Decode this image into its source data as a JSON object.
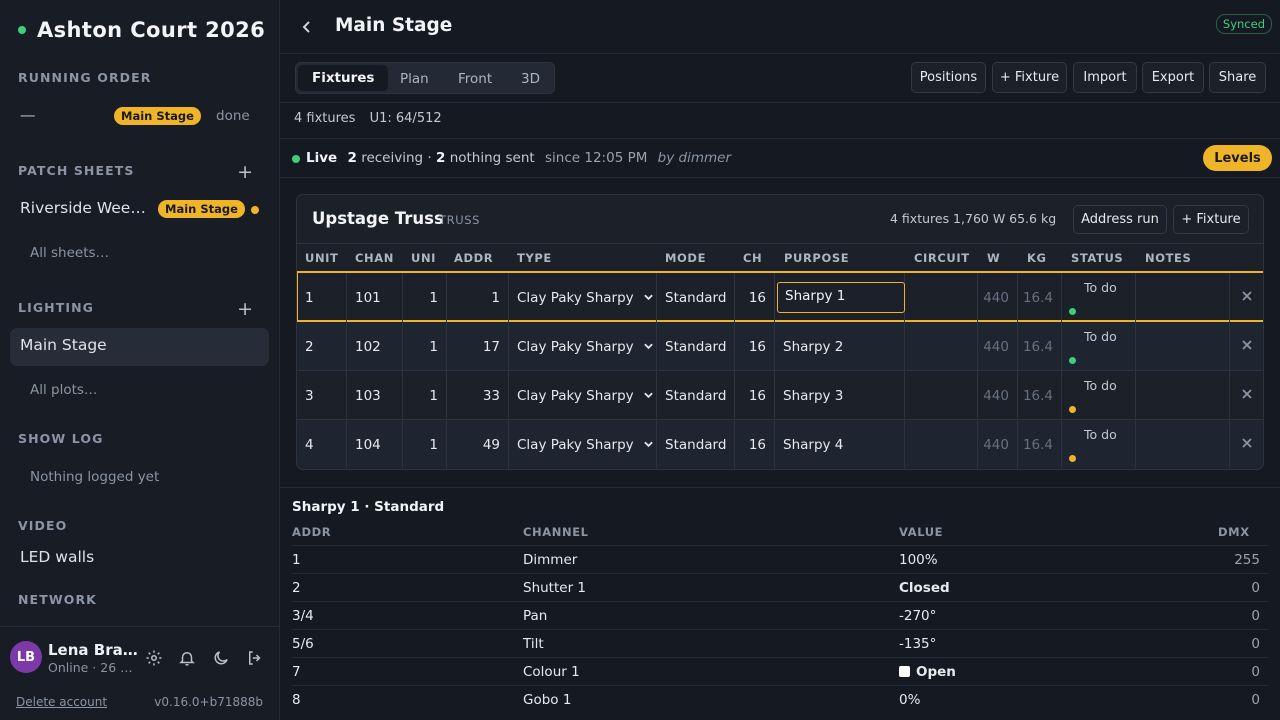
{
  "sidebar": {
    "brand": "Ashton Court 2026",
    "running_order": {
      "title": "RUNNING ORDER",
      "dash": "—",
      "pill": "Main Stage",
      "status": "done"
    },
    "patch_sheets": {
      "title": "PATCH SHEETS",
      "item": "Riverside Wee…",
      "pill": "Main Stage",
      "all": "All sheets…"
    },
    "lighting": {
      "title": "LIGHTING",
      "item": "Main Stage",
      "all": "All plots…"
    },
    "show_log": {
      "title": "SHOW LOG",
      "empty": "Nothing logged yet"
    },
    "video": {
      "title": "VIDEO",
      "item": "LED walls"
    },
    "network": {
      "title": "NETWORK"
    },
    "user": {
      "initials": "LB",
      "name": "Lena Bra…",
      "status": "Online · 26 …",
      "delete": "Delete account",
      "version": "v0.16.0+b71888b"
    }
  },
  "header": {
    "title": "Main Stage",
    "synced": "Synced"
  },
  "tabs": [
    "Fixtures",
    "Plan",
    "Front",
    "3D"
  ],
  "toolbar": {
    "positions": "Positions",
    "add_fixture": "+ Fixture",
    "import": "Import",
    "export": "Export",
    "share": "Share"
  },
  "counts": {
    "fixtures": "4 fixtures",
    "universe": "U1: 64/512"
  },
  "live": {
    "label": "Live",
    "receiving_n": "2",
    "receiving": "receiving ·",
    "nothing_n": "2",
    "nothing": "nothing sent",
    "since": "since 12:05 PM",
    "by": "by dimmer",
    "levels": "Levels"
  },
  "truss": {
    "name": "Upstage Truss",
    "tag": "TRUSS",
    "stats": "4 fixtures   1,760 W   65.6 kg",
    "address_run": "Address run",
    "add_fixture": "+ Fixture",
    "columns": [
      "UNIT",
      "CHAN",
      "UNI",
      "ADDR",
      "TYPE",
      "MODE",
      "CH",
      "PURPOSE",
      "CIRCUIT",
      "W",
      "KG",
      "STATUS",
      "NOTES"
    ],
    "rows": [
      {
        "unit": "1",
        "chan": "101",
        "uni": "1",
        "addr": "1",
        "type": "Clay Paky Sharpy",
        "mode": "Standard",
        "ch": "16",
        "purpose": "Sharpy 1",
        "w": "440",
        "kg": "16.4",
        "status": "To do",
        "dot": "#3ecf7b"
      },
      {
        "unit": "2",
        "chan": "102",
        "uni": "1",
        "addr": "17",
        "type": "Clay Paky Sharpy",
        "mode": "Standard",
        "ch": "16",
        "purpose": "Sharpy 2",
        "w": "440",
        "kg": "16.4",
        "status": "To do",
        "dot": "#3ecf7b"
      },
      {
        "unit": "3",
        "chan": "103",
        "uni": "1",
        "addr": "33",
        "type": "Clay Paky Sharpy",
        "mode": "Standard",
        "ch": "16",
        "purpose": "Sharpy 3",
        "w": "440",
        "kg": "16.4",
        "status": "To do",
        "dot": "#f0b429"
      },
      {
        "unit": "4",
        "chan": "104",
        "uni": "1",
        "addr": "49",
        "type": "Clay Paky Sharpy",
        "mode": "Standard",
        "ch": "16",
        "purpose": "Sharpy 4",
        "w": "440",
        "kg": "16.4",
        "status": "To do",
        "dot": "#f0b429"
      }
    ]
  },
  "detail": {
    "title": "Sharpy 1 · Standard",
    "columns": [
      "ADDR",
      "CHANNEL",
      "VALUE",
      "DMX"
    ],
    "rows": [
      {
        "addr": "1",
        "channel": "Dimmer",
        "value": "100%",
        "dmx": "255"
      },
      {
        "addr": "2",
        "channel": "Shutter 1",
        "value": "Closed",
        "dmx": "0"
      },
      {
        "addr": "3/4",
        "channel": "Pan",
        "value": "-270°",
        "dmx": "0"
      },
      {
        "addr": "5/6",
        "channel": "Tilt",
        "value": "-135°",
        "dmx": "0"
      },
      {
        "addr": "7",
        "channel": "Colour 1",
        "value": "Open",
        "dmx": "0"
      },
      {
        "addr": "8",
        "channel": "Gobo 1",
        "value": "0%",
        "dmx": "0"
      }
    ]
  },
  "colors": {
    "accent": "#f0b429",
    "live": "#3ecf7b",
    "avatar": "#7c3aa8"
  }
}
